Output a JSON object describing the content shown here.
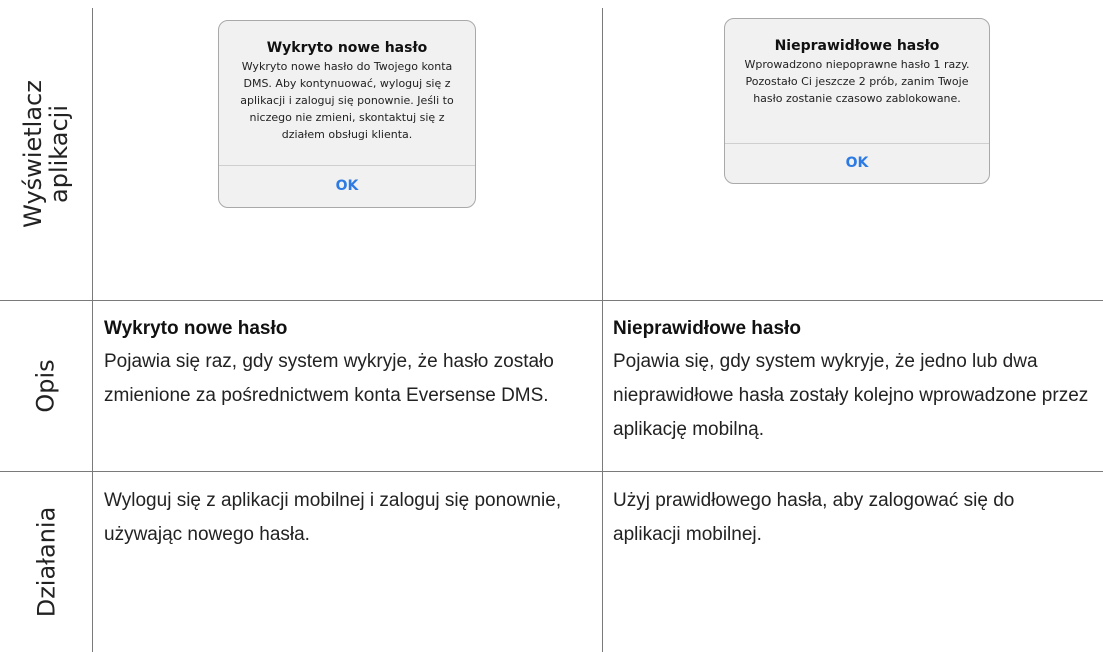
{
  "rows": {
    "display": "Wyświetlacz\naplikacji",
    "description": "Opis",
    "actions": "Działania"
  },
  "left_alert": {
    "title": "Wykryto nowe hasło",
    "body": "Wykryto nowe hasło do Twojego konta DMS. Aby kontynuować, wyloguj się z aplikacji i zaloguj się ponownie. Jeśli to niczego nie zmieni, skontaktuj się z działem obsługi klienta.",
    "button": "OK"
  },
  "right_alert": {
    "title": "Nieprawidłowe hasło",
    "body": "Wprowadzono niepoprawne hasło 1 razy. Pozostało Ci jeszcze 2 prób, zanim Twoje hasło zostanie czasowo zablokowane.",
    "button": "OK"
  },
  "description": {
    "left_title": "Wykryto nowe hasło",
    "left_text": "Pojawia się raz, gdy system wykryje, że hasło zostało zmienione za pośrednictwem konta Eversense DMS.",
    "right_title": "Nieprawidłowe hasło",
    "right_text": "Pojawia się, gdy system wykryje, że jedno lub dwa nieprawidłowe hasła zostały kolejno wprowadzone przez aplikację mobilną."
  },
  "actions": {
    "left_text": "Wyloguj się z aplikacji mobilnej i zaloguj się ponownie, używając nowego hasła.",
    "right_text": "Użyj prawidłowego hasła, aby zalogować się do aplikacji mobilnej."
  },
  "colors": {
    "grid": "#7a7a7a",
    "alert_bg": "#f1f1f1",
    "link_blue": "#2c7be5"
  }
}
